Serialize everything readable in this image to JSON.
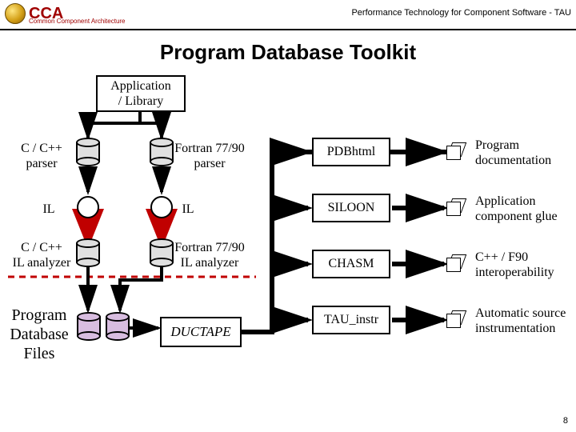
{
  "header": {
    "logo_text": "CCA",
    "logo_subtitle": "Common Component Architecture",
    "right_text": "Performance Technology for Component Software - TAU"
  },
  "title": "Program Database Toolkit",
  "left": {
    "app_library": "Application\n/ Library",
    "c_parser": "C / C++\nparser",
    "fortran_parser": "Fortran 77/90\nparser",
    "il_left": "IL",
    "il_right": "IL",
    "c_analyzer": "C / C++\nIL analyzer",
    "fortran_analyzer": "Fortran 77/90\nIL analyzer",
    "pdb_files": "Program\nDatabase\nFiles",
    "ductape": "DUCTAPE"
  },
  "right": {
    "pdbhtml": {
      "box": "PDBhtml",
      "desc": "Program\ndocumentation"
    },
    "siloon": {
      "box": "SILOON",
      "desc": "Application\ncomponent glue"
    },
    "chasm": {
      "box": "CHASM",
      "desc": "C++ / F90\ninteroperability"
    },
    "tau": {
      "box": "TAU_instr",
      "desc": "Automatic source\ninstrumentation"
    }
  },
  "page_number": "8"
}
